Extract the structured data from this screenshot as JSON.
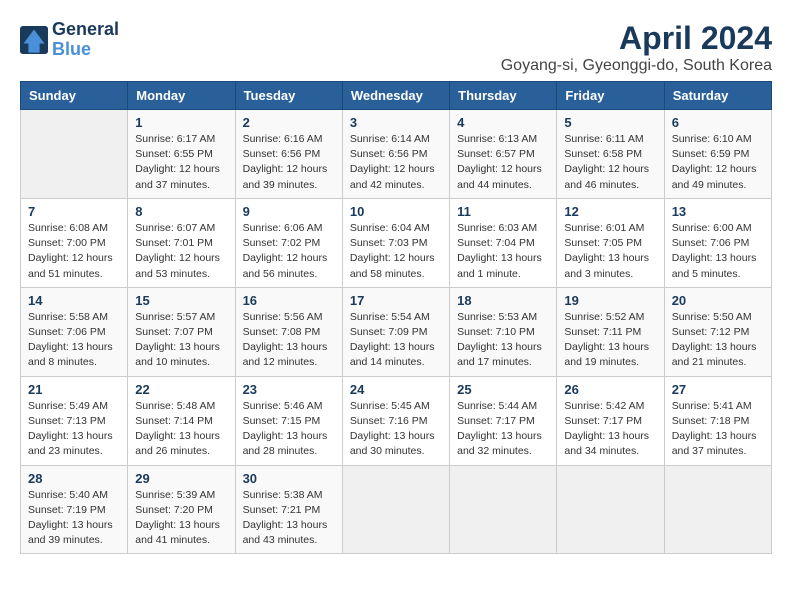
{
  "logo": {
    "text_general": "General",
    "text_blue": "Blue"
  },
  "title": "April 2024",
  "subtitle": "Goyang-si, Gyeonggi-do, South Korea",
  "headers": [
    "Sunday",
    "Monday",
    "Tuesday",
    "Wednesday",
    "Thursday",
    "Friday",
    "Saturday"
  ],
  "weeks": [
    [
      {
        "num": "",
        "info": ""
      },
      {
        "num": "1",
        "info": "Sunrise: 6:17 AM\nSunset: 6:55 PM\nDaylight: 12 hours\nand 37 minutes."
      },
      {
        "num": "2",
        "info": "Sunrise: 6:16 AM\nSunset: 6:56 PM\nDaylight: 12 hours\nand 39 minutes."
      },
      {
        "num": "3",
        "info": "Sunrise: 6:14 AM\nSunset: 6:56 PM\nDaylight: 12 hours\nand 42 minutes."
      },
      {
        "num": "4",
        "info": "Sunrise: 6:13 AM\nSunset: 6:57 PM\nDaylight: 12 hours\nand 44 minutes."
      },
      {
        "num": "5",
        "info": "Sunrise: 6:11 AM\nSunset: 6:58 PM\nDaylight: 12 hours\nand 46 minutes."
      },
      {
        "num": "6",
        "info": "Sunrise: 6:10 AM\nSunset: 6:59 PM\nDaylight: 12 hours\nand 49 minutes."
      }
    ],
    [
      {
        "num": "7",
        "info": "Sunrise: 6:08 AM\nSunset: 7:00 PM\nDaylight: 12 hours\nand 51 minutes."
      },
      {
        "num": "8",
        "info": "Sunrise: 6:07 AM\nSunset: 7:01 PM\nDaylight: 12 hours\nand 53 minutes."
      },
      {
        "num": "9",
        "info": "Sunrise: 6:06 AM\nSunset: 7:02 PM\nDaylight: 12 hours\nand 56 minutes."
      },
      {
        "num": "10",
        "info": "Sunrise: 6:04 AM\nSunset: 7:03 PM\nDaylight: 12 hours\nand 58 minutes."
      },
      {
        "num": "11",
        "info": "Sunrise: 6:03 AM\nSunset: 7:04 PM\nDaylight: 13 hours\nand 1 minute."
      },
      {
        "num": "12",
        "info": "Sunrise: 6:01 AM\nSunset: 7:05 PM\nDaylight: 13 hours\nand 3 minutes."
      },
      {
        "num": "13",
        "info": "Sunrise: 6:00 AM\nSunset: 7:06 PM\nDaylight: 13 hours\nand 5 minutes."
      }
    ],
    [
      {
        "num": "14",
        "info": "Sunrise: 5:58 AM\nSunset: 7:06 PM\nDaylight: 13 hours\nand 8 minutes."
      },
      {
        "num": "15",
        "info": "Sunrise: 5:57 AM\nSunset: 7:07 PM\nDaylight: 13 hours\nand 10 minutes."
      },
      {
        "num": "16",
        "info": "Sunrise: 5:56 AM\nSunset: 7:08 PM\nDaylight: 13 hours\nand 12 minutes."
      },
      {
        "num": "17",
        "info": "Sunrise: 5:54 AM\nSunset: 7:09 PM\nDaylight: 13 hours\nand 14 minutes."
      },
      {
        "num": "18",
        "info": "Sunrise: 5:53 AM\nSunset: 7:10 PM\nDaylight: 13 hours\nand 17 minutes."
      },
      {
        "num": "19",
        "info": "Sunrise: 5:52 AM\nSunset: 7:11 PM\nDaylight: 13 hours\nand 19 minutes."
      },
      {
        "num": "20",
        "info": "Sunrise: 5:50 AM\nSunset: 7:12 PM\nDaylight: 13 hours\nand 21 minutes."
      }
    ],
    [
      {
        "num": "21",
        "info": "Sunrise: 5:49 AM\nSunset: 7:13 PM\nDaylight: 13 hours\nand 23 minutes."
      },
      {
        "num": "22",
        "info": "Sunrise: 5:48 AM\nSunset: 7:14 PM\nDaylight: 13 hours\nand 26 minutes."
      },
      {
        "num": "23",
        "info": "Sunrise: 5:46 AM\nSunset: 7:15 PM\nDaylight: 13 hours\nand 28 minutes."
      },
      {
        "num": "24",
        "info": "Sunrise: 5:45 AM\nSunset: 7:16 PM\nDaylight: 13 hours\nand 30 minutes."
      },
      {
        "num": "25",
        "info": "Sunrise: 5:44 AM\nSunset: 7:17 PM\nDaylight: 13 hours\nand 32 minutes."
      },
      {
        "num": "26",
        "info": "Sunrise: 5:42 AM\nSunset: 7:17 PM\nDaylight: 13 hours\nand 34 minutes."
      },
      {
        "num": "27",
        "info": "Sunrise: 5:41 AM\nSunset: 7:18 PM\nDaylight: 13 hours\nand 37 minutes."
      }
    ],
    [
      {
        "num": "28",
        "info": "Sunrise: 5:40 AM\nSunset: 7:19 PM\nDaylight: 13 hours\nand 39 minutes."
      },
      {
        "num": "29",
        "info": "Sunrise: 5:39 AM\nSunset: 7:20 PM\nDaylight: 13 hours\nand 41 minutes."
      },
      {
        "num": "30",
        "info": "Sunrise: 5:38 AM\nSunset: 7:21 PM\nDaylight: 13 hours\nand 43 minutes."
      },
      {
        "num": "",
        "info": ""
      },
      {
        "num": "",
        "info": ""
      },
      {
        "num": "",
        "info": ""
      },
      {
        "num": "",
        "info": ""
      }
    ]
  ]
}
